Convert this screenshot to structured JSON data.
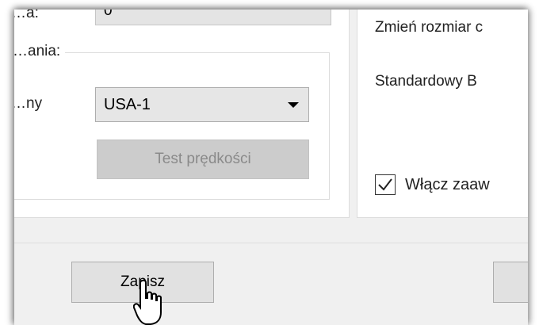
{
  "left_panel": {
    "top_label": "…a:",
    "top_value": "0",
    "group_title": "…ania:",
    "server_label": "…ny",
    "server_select": {
      "value": "USA-1"
    },
    "speed_test_label": "Test prędkości"
  },
  "right_panel": {
    "resize_text": "Zmień rozmiar c",
    "standard_text": "Standardowy B",
    "advanced_checkbox": {
      "checked": true,
      "label": "Włącz zaaw"
    }
  },
  "footer": {
    "save_label": "Zapisz"
  },
  "icons": [
    "chevron-down-icon",
    "checkmark-icon",
    "hand-cursor-icon"
  ]
}
